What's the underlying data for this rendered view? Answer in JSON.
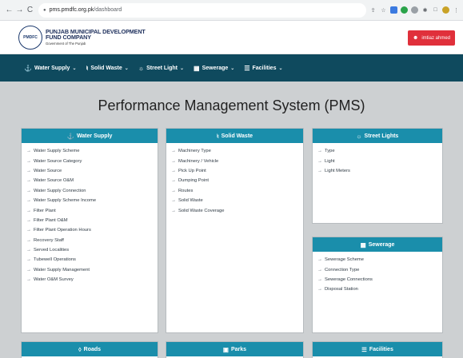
{
  "browser": {
    "url_host": "pms.pmdfc.org.pk",
    "url_path": "/dashboard",
    "back_glyph": "←",
    "forward_glyph": "→",
    "reload_glyph": "C",
    "lock_glyph": "🔒"
  },
  "header": {
    "logo_text": "PMDFC",
    "brand_line1": "PUNJAB MUNICIPAL DEVELOPMENT",
    "brand_line2": "FUND COMPANY",
    "brand_sub": "Government of The Punjab",
    "user_name": "imtiaz ahmed",
    "colors": {
      "user_button": "#e0303b",
      "brand_text": "#1d2f5c"
    }
  },
  "menu": {
    "color": "#0f4a5e",
    "items": [
      {
        "label": "Water Supply",
        "icon": "faucet-icon",
        "glyph": "🚰"
      },
      {
        "label": "Solid Waste",
        "icon": "recycle-icon",
        "glyph": "♲"
      },
      {
        "label": "Street Light",
        "icon": "lamp-icon",
        "glyph": "🔦"
      },
      {
        "label": "Sewerage",
        "icon": "drain-icon",
        "glyph": "▦"
      },
      {
        "label": "Facilities",
        "icon": "list-icon",
        "glyph": "☰"
      }
    ]
  },
  "main": {
    "title": "Performance Management System (PMS)",
    "card_header_color": "#1a8eab",
    "cards": [
      {
        "title": "Water Supply",
        "icon": "faucet-icon",
        "items": [
          "Water Supply Scheme",
          "Water Source Category",
          "Water Source",
          "Water Source O&M",
          "Water Supply Connection",
          "Water Supply Scheme Income",
          "Filter Plant",
          "Filter Plant O&M",
          "Filter Plant Operation Hours",
          "Recovery Staff",
          "Served Localities",
          "Tubewell Operations",
          "Water Supply Management",
          "Water O&M Survey"
        ]
      },
      {
        "title": "Solid Waste",
        "icon": "recycle-icon",
        "items": [
          "Machinery Type",
          "Machinery / Vehicle",
          "Pick Up Point",
          "Dumping Point",
          "Routes",
          "Solid Waste",
          "Solid Waste Coverage"
        ]
      },
      {
        "title": "Street Lights",
        "icon": "lamp-icon",
        "items": [
          "Type",
          "Light",
          "Light Meters"
        ]
      },
      {
        "title": "Sewerage",
        "icon": "drain-icon",
        "items": [
          "Sewerage Scheme",
          "Connection Type",
          "Sewerage Connections",
          "Disposal Station"
        ]
      },
      {
        "title": "Roads",
        "icon": "road-icon",
        "items": []
      },
      {
        "title": "Parks",
        "icon": "park-icon",
        "items": []
      },
      {
        "title": "Facilities",
        "icon": "list-icon",
        "items": []
      }
    ]
  }
}
